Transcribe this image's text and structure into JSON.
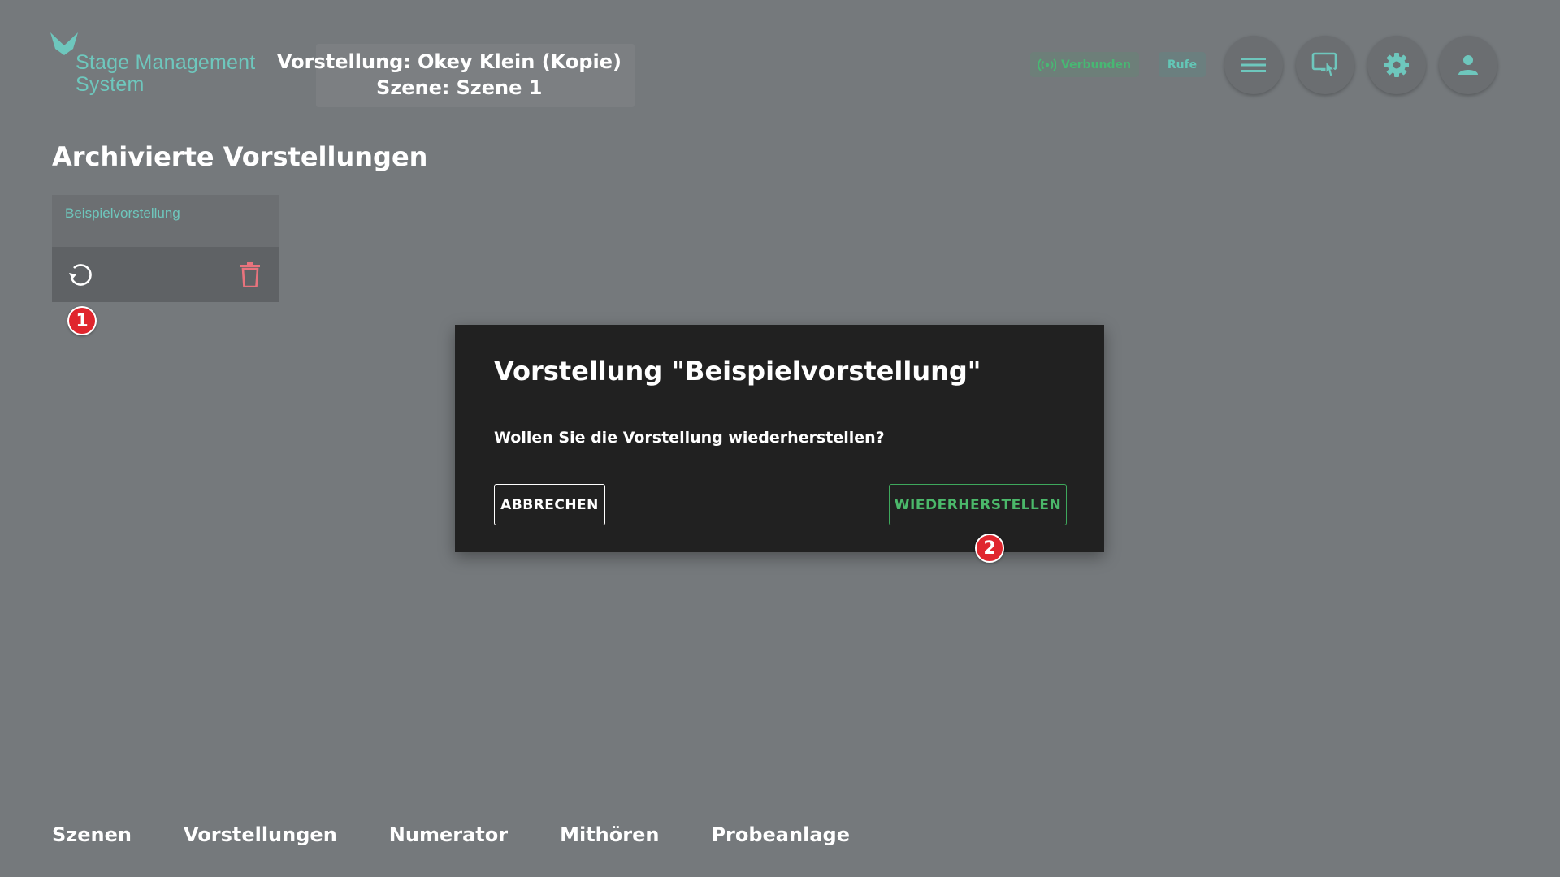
{
  "header": {
    "logo_text": "Stage Management System",
    "logo_line1": "Stage Management",
    "logo_line2": "System",
    "current": {
      "show_label": "Vorstellung:",
      "show_value": "Okey Klein (Kopie)",
      "scene_label": "Szene:",
      "scene_value": "Szene 1"
    },
    "status": {
      "connected_label": "Verbunden",
      "connected_icon": "broadcast-icon",
      "calls_label": "Rufe"
    },
    "buttons": [
      {
        "name": "menu-button",
        "icon": "menu-icon"
      },
      {
        "name": "display-button",
        "icon": "screen-touch-icon"
      },
      {
        "name": "settings-button",
        "icon": "gear-icon"
      },
      {
        "name": "account-button",
        "icon": "person-icon"
      }
    ]
  },
  "page": {
    "title": "Archivierte Vorstellungen"
  },
  "archived_shows": [
    {
      "name": "Beispielvorstellung",
      "actions": [
        "restore-icon",
        "delete-icon"
      ]
    }
  ],
  "markers": [
    "1",
    "2"
  ],
  "dialog": {
    "title": "Vorstellung \"Beispielvorstellung\"",
    "message": "Wollen Sie die Vorstellung wiederherstellen?",
    "cancel_label": "ABBRECHEN",
    "confirm_label": "WIEDERHERSTELLEN"
  },
  "bottom_nav": {
    "items": [
      "Szenen",
      "Vorstellungen",
      "Numerator",
      "Mithören",
      "Probeanlage"
    ]
  },
  "colors": {
    "background": "#75797c",
    "accent_teal": "#6ec7bd",
    "success_green": "#4bb86a",
    "dialog_bg": "#212121",
    "marker_red": "#e0262e",
    "delete_pink": "#e8737d"
  }
}
